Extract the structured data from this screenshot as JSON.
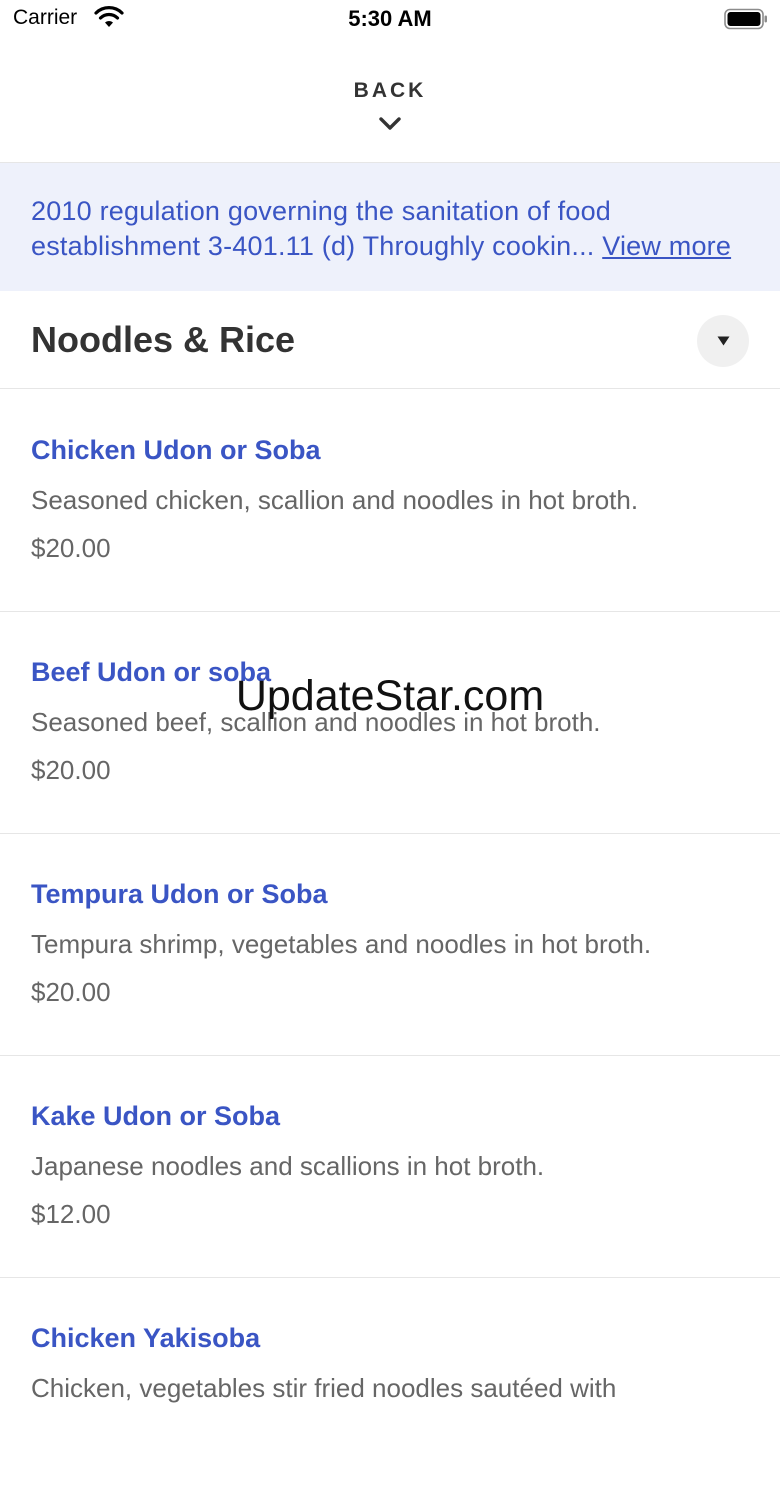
{
  "status_bar": {
    "carrier": "Carrier",
    "time": "5:30 AM"
  },
  "header": {
    "back_label": "BACK",
    "back_icon": "chevron-down-icon"
  },
  "notice": {
    "text": "2010 regulation governing the sanitation of food establishment 3-401.11 (d) Throughly cookin...",
    "link_label": "View more"
  },
  "section": {
    "title": "Noodles & Rice",
    "toggle_icon": "caret-down-icon"
  },
  "items": [
    {
      "name": "Chicken Udon or Soba",
      "description": "Seasoned chicken, scallion and noodles in hot broth.",
      "price": "$20.00"
    },
    {
      "name": "Beef Udon or soba",
      "description": "Seasoned beef, scallion and noodles in hot broth.",
      "price": "$20.00"
    },
    {
      "name": "Tempura Udon or Soba",
      "description": "Tempura shrimp, vegetables and noodles in hot broth.",
      "price": "$20.00"
    },
    {
      "name": "Kake Udon or Soba",
      "description": "Japanese noodles and scallions in hot broth.",
      "price": "$12.00"
    },
    {
      "name": "Chicken Yakisoba",
      "description": "Chicken, vegetables stir fried noodles sautéed with",
      "price": ""
    }
  ],
  "watermark": "UpdateStar.com",
  "colors": {
    "accent": "#3a55c4",
    "notice_bg": "#eef1fb",
    "divider": "#e6e6e6",
    "muted_text": "#666666"
  }
}
